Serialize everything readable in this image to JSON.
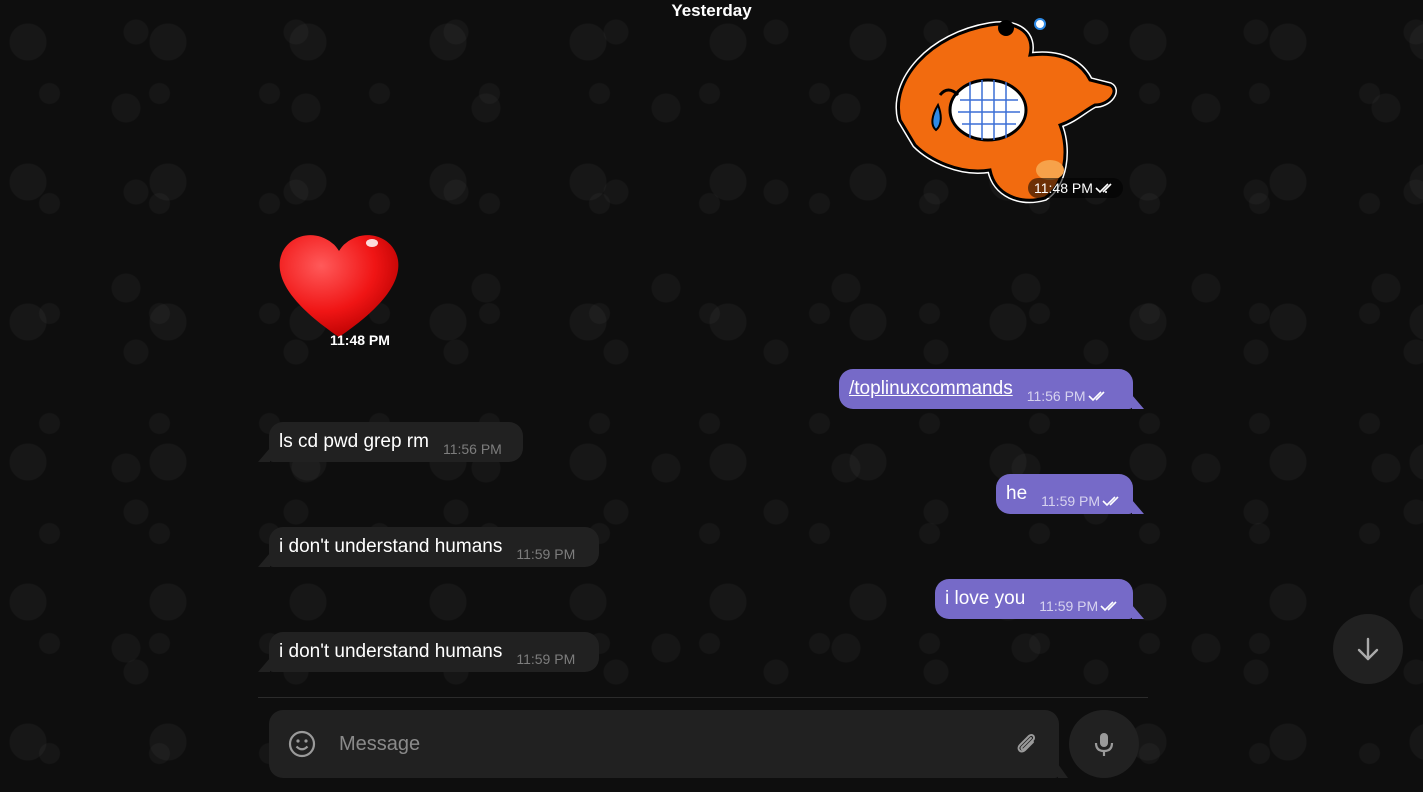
{
  "date_separator": "Yesterday",
  "colors": {
    "outgoing_bubble": "#766ac8",
    "incoming_bubble": "#212121",
    "background": "#0e0e0e"
  },
  "stickers": [
    {
      "name": "laughing-crying-fox-sticker",
      "direction": "outgoing",
      "time": "11:48 PM",
      "status": "read"
    },
    {
      "name": "red-heart-emoji",
      "direction": "incoming",
      "time": "11:48 PM"
    }
  ],
  "messages": [
    {
      "direction": "outgoing",
      "text": "/toplinuxcommands",
      "is_link": true,
      "time": "11:56 PM",
      "status": "read"
    },
    {
      "direction": "incoming",
      "text": "ls cd pwd grep rm",
      "time": "11:56 PM"
    },
    {
      "direction": "outgoing",
      "text": "he",
      "time": "11:59 PM",
      "status": "read"
    },
    {
      "direction": "incoming",
      "text": "i don't understand humans",
      "time": "11:59 PM"
    },
    {
      "direction": "outgoing",
      "text": "i love you",
      "time": "11:59 PM",
      "status": "read"
    },
    {
      "direction": "incoming",
      "text": "i don't understand humans",
      "time": "11:59 PM"
    }
  ],
  "composer": {
    "placeholder": "Message",
    "emoji_icon": "smiley-icon",
    "attach_icon": "paperclip-icon",
    "mic_icon": "microphone-icon"
  },
  "scroll_down_icon": "arrow-down-icon"
}
